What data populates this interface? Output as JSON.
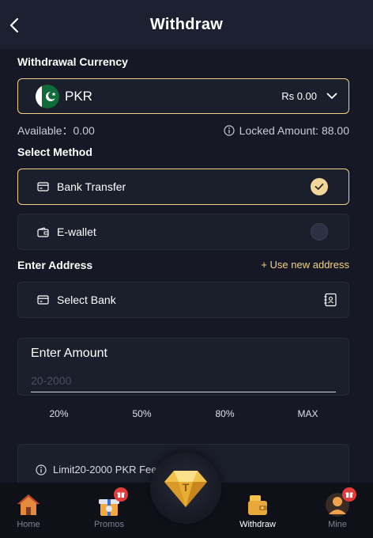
{
  "header": {
    "title": "Withdraw"
  },
  "currency": {
    "section_label": "Withdrawal Currency",
    "code": "PKR",
    "balance": "Rs 0.00"
  },
  "balance_info": {
    "available": "Available：0.00",
    "locked": "Locked Amount: 88.00"
  },
  "method": {
    "section_label": "Select Method",
    "options": [
      {
        "label": "Bank Transfer",
        "selected": true
      },
      {
        "label": "E-wallet",
        "selected": false
      }
    ]
  },
  "address": {
    "section_label": "Enter Address",
    "use_new_label": "+ Use new address",
    "select_bank_label": "Select Bank"
  },
  "amount": {
    "title": "Enter Amount",
    "placeholder": "20-2000",
    "value": "",
    "quick_picks": [
      "20%",
      "50%",
      "80%",
      "MAX"
    ]
  },
  "limit": {
    "text": "Limit20-2000 PKR Fee 0%"
  },
  "tabbar": {
    "tabs": [
      {
        "label": "Home",
        "active": false
      },
      {
        "label": "Promos",
        "active": false
      },
      {
        "label": "Withdraw",
        "active": true
      },
      {
        "label": "Mine",
        "active": false
      }
    ]
  },
  "colors": {
    "accent": "#f2d28a",
    "background": "#161925",
    "card": "#1b1e2b",
    "flag_green": "#0f6b3a",
    "badge_red": "#e23b3b"
  }
}
